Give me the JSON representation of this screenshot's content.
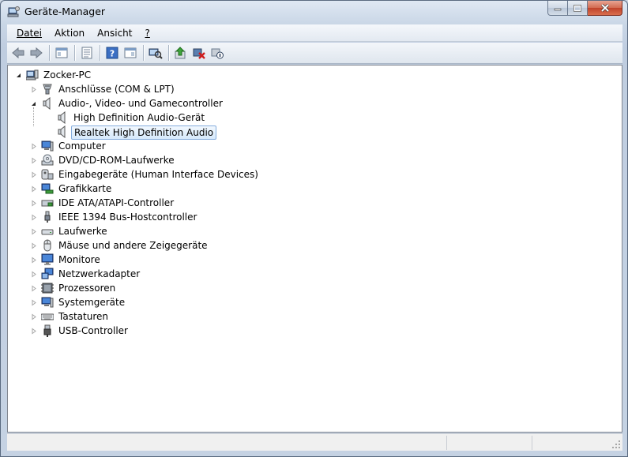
{
  "window": {
    "title": "Geräte-Manager",
    "accent": "#c4d3e5"
  },
  "menu": [
    {
      "label": "Datei",
      "mnemonic_index": 0
    },
    {
      "label": "Aktion",
      "mnemonic_index": 1
    },
    {
      "label": "Ansicht",
      "mnemonic_index": 0
    },
    {
      "label": "?",
      "mnemonic_index": 0
    }
  ],
  "toolbar": {
    "buttons": [
      "back-icon",
      "forward-icon",
      "show-hide-tree-icon",
      "properties-icon",
      "help-icon",
      "show-hide-action-pane-icon",
      "scan-hardware-icon",
      "update-driver-icon",
      "uninstall-icon",
      "disable-device-icon"
    ]
  },
  "tree": {
    "root": "Zocker-PC",
    "nodes": [
      {
        "label": "Anschlüsse (COM & LPT)",
        "icon": "port-icon",
        "expanded": false
      },
      {
        "label": "Audio-, Video- und Gamecontroller",
        "icon": "speaker-icon",
        "expanded": true,
        "children": [
          {
            "label": "High Definition Audio-Gerät",
            "icon": "speaker-icon",
            "selected": false
          },
          {
            "label": "Realtek High Definition Audio",
            "icon": "speaker-icon",
            "selected": true
          }
        ]
      },
      {
        "label": "Computer",
        "icon": "computer-icon",
        "expanded": false
      },
      {
        "label": "DVD/CD-ROM-Laufwerke",
        "icon": "optical-drive-icon",
        "expanded": false
      },
      {
        "label": "Eingabegeräte (Human Interface Devices)",
        "icon": "hid-icon",
        "expanded": false
      },
      {
        "label": "Grafikkarte",
        "icon": "display-adapter-icon",
        "expanded": false
      },
      {
        "label": "IDE ATA/ATAPI-Controller",
        "icon": "ide-controller-icon",
        "expanded": false
      },
      {
        "label": "IEEE 1394 Bus-Hostcontroller",
        "icon": "firewire-icon",
        "expanded": false
      },
      {
        "label": "Laufwerke",
        "icon": "disk-drive-icon",
        "expanded": false
      },
      {
        "label": "Mäuse und andere Zeigegeräte",
        "icon": "mouse-icon",
        "expanded": false
      },
      {
        "label": "Monitore",
        "icon": "monitor-icon",
        "expanded": false
      },
      {
        "label": "Netzwerkadapter",
        "icon": "network-adapter-icon",
        "expanded": false
      },
      {
        "label": "Prozessoren",
        "icon": "processor-icon",
        "expanded": false
      },
      {
        "label": "Systemgeräte",
        "icon": "system-device-icon",
        "expanded": false
      },
      {
        "label": "Tastaturen",
        "icon": "keyboard-icon",
        "expanded": false
      },
      {
        "label": "USB-Controller",
        "icon": "usb-icon",
        "expanded": false
      }
    ]
  }
}
